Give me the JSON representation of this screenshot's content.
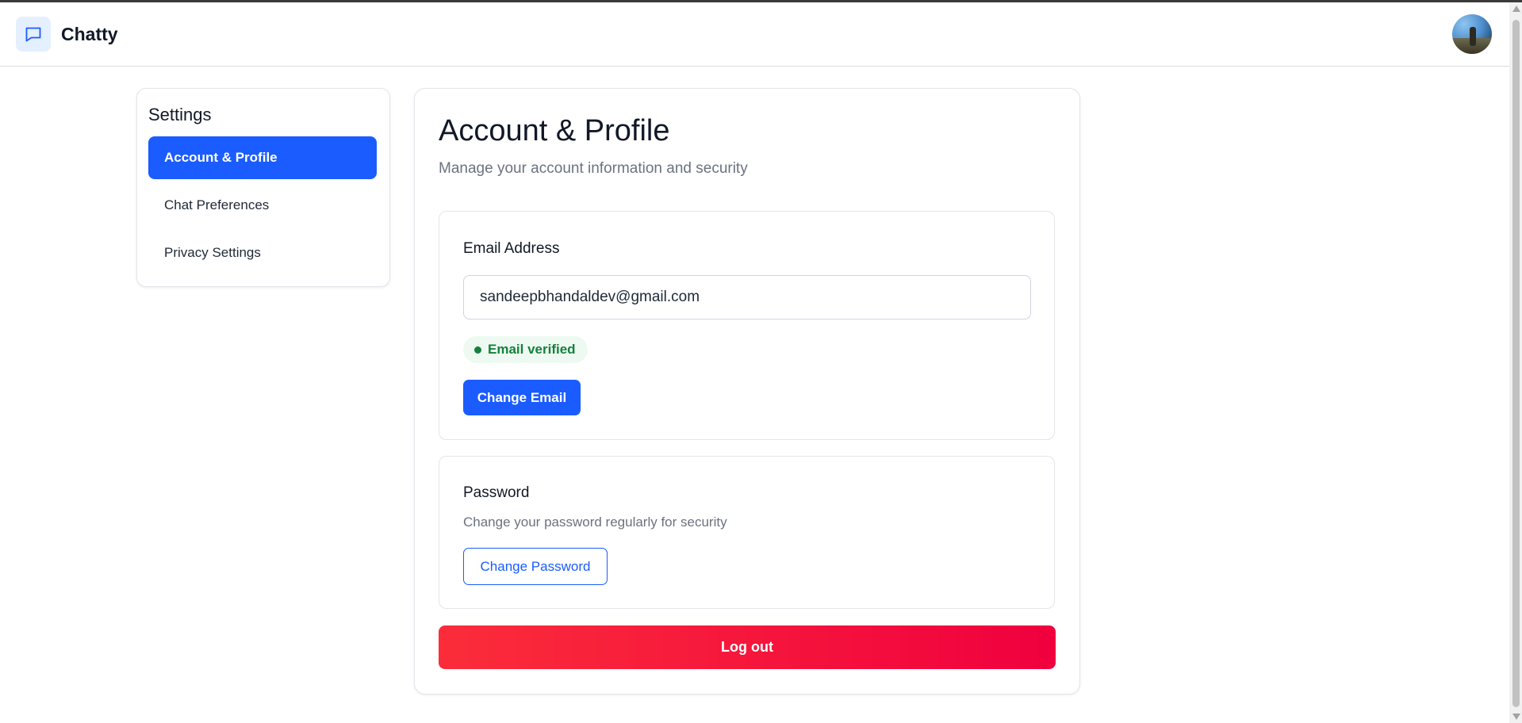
{
  "app": {
    "name": "Chatty",
    "logo_icon": "chat-bubble-icon",
    "avatar_icon": "user-avatar-photo"
  },
  "sidebar": {
    "title": "Settings",
    "items": [
      {
        "label": "Account & Profile",
        "active": true
      },
      {
        "label": "Chat Preferences",
        "active": false
      },
      {
        "label": "Privacy Settings",
        "active": false
      }
    ]
  },
  "main": {
    "title": "Account & Profile",
    "subtitle": "Manage your account information and security",
    "email_section": {
      "label": "Email Address",
      "value": "sandeepbhandaldev@gmail.com",
      "status": "Email verified",
      "button_label": "Change Email"
    },
    "password_section": {
      "label": "Password",
      "description": "Change your password regularly for security",
      "button_label": "Change Password"
    },
    "logout_label": "Log out"
  },
  "colors": {
    "accent": "#1a5cff",
    "success": "#15803d",
    "danger_start": "#fb2d3a",
    "danger_end": "#f0003e"
  }
}
